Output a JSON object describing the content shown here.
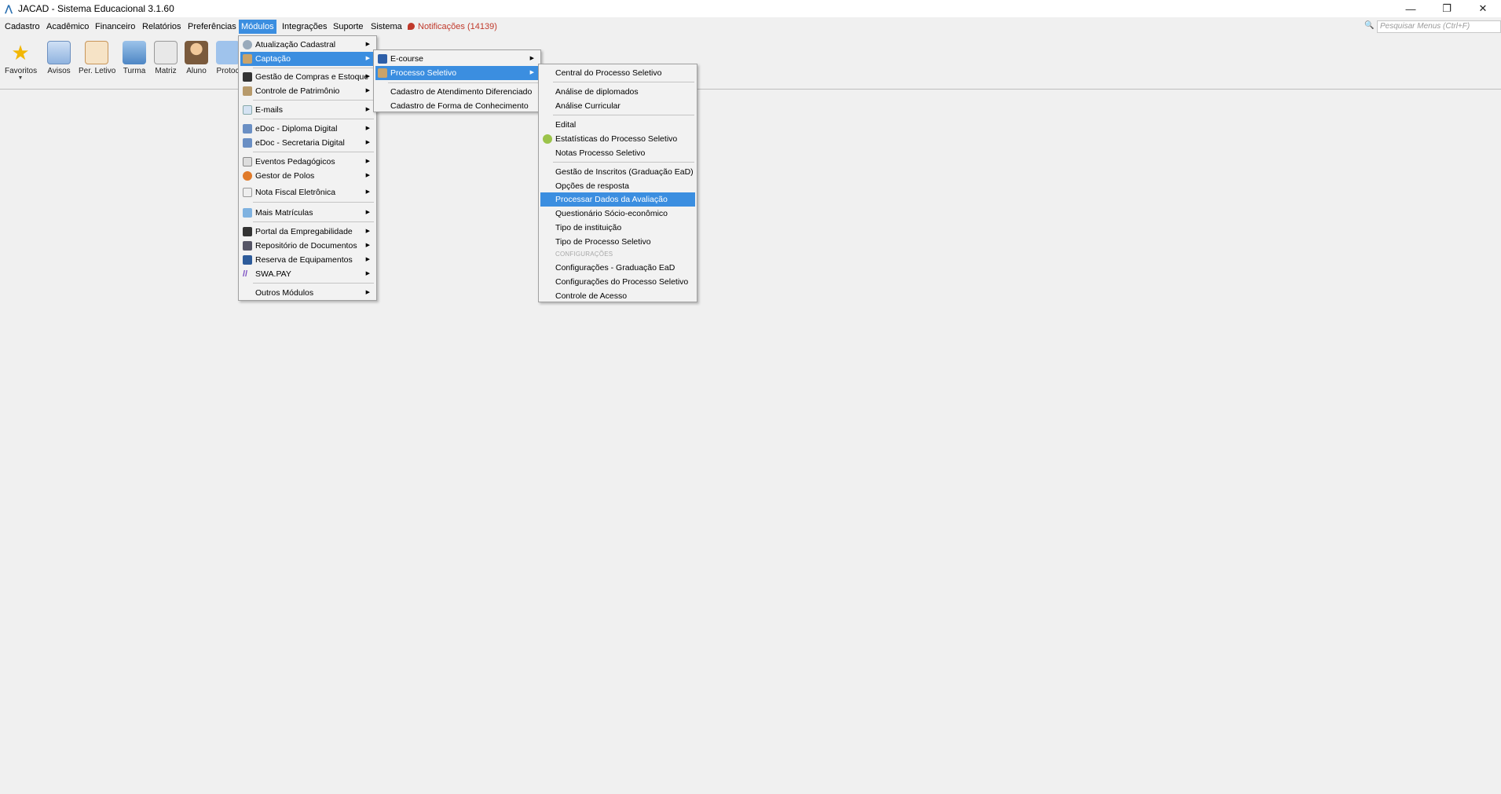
{
  "window": {
    "title": "JACAD - Sistema Educacional 3.1.60",
    "minimize": "—",
    "restore": "❐",
    "close": "✕"
  },
  "menubar": {
    "items": [
      "Cadastro",
      "Acadêmico",
      "Financeiro",
      "Relatórios",
      "Preferências",
      "Módulos",
      "Integrações",
      "Suporte",
      "Sistema"
    ],
    "notifications": "Notificações (14139)",
    "search_placeholder": "Pesquisar Menus (Ctrl+F)"
  },
  "toolbar": {
    "items": [
      "Favoritos",
      "Avisos",
      "Per. Letivo",
      "Turma",
      "Matriz",
      "Aluno",
      "Protoc"
    ]
  },
  "modulos_menu": {
    "items": [
      "Atualização Cadastral",
      "Captação",
      "Gestão de Compras e Estoque",
      "Controle de Patrimônio",
      "E-mails",
      "eDoc - Diploma Digital",
      "eDoc - Secretaria Digital",
      "Eventos Pedagógicos",
      "Gestor de Polos",
      "Nota Fiscal Eletrônica",
      "Mais Matrículas",
      "Portal da Empregabilidade",
      "Repositório de Documentos",
      "Reserva de Equipamentos",
      "SWA.PAY",
      "Outros Módulos"
    ]
  },
  "captacao_menu": {
    "items": [
      "E-course",
      "Processo Seletivo",
      "Cadastro de Atendimento Diferenciado",
      "Cadastro de Forma de Conhecimento"
    ]
  },
  "processo_menu": {
    "items": [
      "Central do Processo Seletivo",
      "Análise de diplomados",
      "Análise Curricular",
      "Edital",
      "Estatísticas do Processo Seletivo",
      "Notas Processo Seletivo",
      "Gestão de Inscritos (Graduação EaD)",
      "Opções de resposta",
      "Processar Dados da Avaliação",
      "Questionário Sócio-econômico",
      "Tipo de instituição",
      "Tipo de Processo Seletivo"
    ],
    "section_label": "CONFIGURAÇÕES",
    "config_items": [
      "Configurações - Graduação EaD",
      "Configurações do Processo Seletivo",
      "Controle de Acesso"
    ]
  },
  "colors": {
    "highlight": "#3b8ee0",
    "notification": "#c0392b"
  }
}
